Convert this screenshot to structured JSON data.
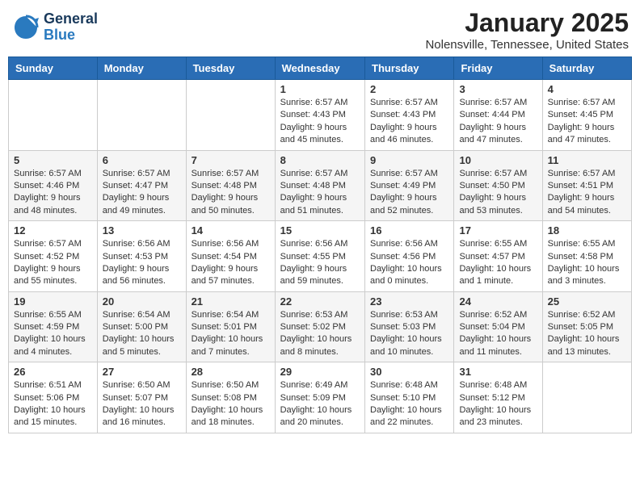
{
  "logo": {
    "line1": "General",
    "line2": "Blue"
  },
  "title": "January 2025",
  "location": "Nolensville, Tennessee, United States",
  "weekdays": [
    "Sunday",
    "Monday",
    "Tuesday",
    "Wednesday",
    "Thursday",
    "Friday",
    "Saturday"
  ],
  "weeks": [
    [
      {
        "day": "",
        "info": ""
      },
      {
        "day": "",
        "info": ""
      },
      {
        "day": "",
        "info": ""
      },
      {
        "day": "1",
        "info": "Sunrise: 6:57 AM\nSunset: 4:43 PM\nDaylight: 9 hours and 45 minutes."
      },
      {
        "day": "2",
        "info": "Sunrise: 6:57 AM\nSunset: 4:43 PM\nDaylight: 9 hours and 46 minutes."
      },
      {
        "day": "3",
        "info": "Sunrise: 6:57 AM\nSunset: 4:44 PM\nDaylight: 9 hours and 47 minutes."
      },
      {
        "day": "4",
        "info": "Sunrise: 6:57 AM\nSunset: 4:45 PM\nDaylight: 9 hours and 47 minutes."
      }
    ],
    [
      {
        "day": "5",
        "info": "Sunrise: 6:57 AM\nSunset: 4:46 PM\nDaylight: 9 hours and 48 minutes."
      },
      {
        "day": "6",
        "info": "Sunrise: 6:57 AM\nSunset: 4:47 PM\nDaylight: 9 hours and 49 minutes."
      },
      {
        "day": "7",
        "info": "Sunrise: 6:57 AM\nSunset: 4:48 PM\nDaylight: 9 hours and 50 minutes."
      },
      {
        "day": "8",
        "info": "Sunrise: 6:57 AM\nSunset: 4:48 PM\nDaylight: 9 hours and 51 minutes."
      },
      {
        "day": "9",
        "info": "Sunrise: 6:57 AM\nSunset: 4:49 PM\nDaylight: 9 hours and 52 minutes."
      },
      {
        "day": "10",
        "info": "Sunrise: 6:57 AM\nSunset: 4:50 PM\nDaylight: 9 hours and 53 minutes."
      },
      {
        "day": "11",
        "info": "Sunrise: 6:57 AM\nSunset: 4:51 PM\nDaylight: 9 hours and 54 minutes."
      }
    ],
    [
      {
        "day": "12",
        "info": "Sunrise: 6:57 AM\nSunset: 4:52 PM\nDaylight: 9 hours and 55 minutes."
      },
      {
        "day": "13",
        "info": "Sunrise: 6:56 AM\nSunset: 4:53 PM\nDaylight: 9 hours and 56 minutes."
      },
      {
        "day": "14",
        "info": "Sunrise: 6:56 AM\nSunset: 4:54 PM\nDaylight: 9 hours and 57 minutes."
      },
      {
        "day": "15",
        "info": "Sunrise: 6:56 AM\nSunset: 4:55 PM\nDaylight: 9 hours and 59 minutes."
      },
      {
        "day": "16",
        "info": "Sunrise: 6:56 AM\nSunset: 4:56 PM\nDaylight: 10 hours and 0 minutes."
      },
      {
        "day": "17",
        "info": "Sunrise: 6:55 AM\nSunset: 4:57 PM\nDaylight: 10 hours and 1 minute."
      },
      {
        "day": "18",
        "info": "Sunrise: 6:55 AM\nSunset: 4:58 PM\nDaylight: 10 hours and 3 minutes."
      }
    ],
    [
      {
        "day": "19",
        "info": "Sunrise: 6:55 AM\nSunset: 4:59 PM\nDaylight: 10 hours and 4 minutes."
      },
      {
        "day": "20",
        "info": "Sunrise: 6:54 AM\nSunset: 5:00 PM\nDaylight: 10 hours and 5 minutes."
      },
      {
        "day": "21",
        "info": "Sunrise: 6:54 AM\nSunset: 5:01 PM\nDaylight: 10 hours and 7 minutes."
      },
      {
        "day": "22",
        "info": "Sunrise: 6:53 AM\nSunset: 5:02 PM\nDaylight: 10 hours and 8 minutes."
      },
      {
        "day": "23",
        "info": "Sunrise: 6:53 AM\nSunset: 5:03 PM\nDaylight: 10 hours and 10 minutes."
      },
      {
        "day": "24",
        "info": "Sunrise: 6:52 AM\nSunset: 5:04 PM\nDaylight: 10 hours and 11 minutes."
      },
      {
        "day": "25",
        "info": "Sunrise: 6:52 AM\nSunset: 5:05 PM\nDaylight: 10 hours and 13 minutes."
      }
    ],
    [
      {
        "day": "26",
        "info": "Sunrise: 6:51 AM\nSunset: 5:06 PM\nDaylight: 10 hours and 15 minutes."
      },
      {
        "day": "27",
        "info": "Sunrise: 6:50 AM\nSunset: 5:07 PM\nDaylight: 10 hours and 16 minutes."
      },
      {
        "day": "28",
        "info": "Sunrise: 6:50 AM\nSunset: 5:08 PM\nDaylight: 10 hours and 18 minutes."
      },
      {
        "day": "29",
        "info": "Sunrise: 6:49 AM\nSunset: 5:09 PM\nDaylight: 10 hours and 20 minutes."
      },
      {
        "day": "30",
        "info": "Sunrise: 6:48 AM\nSunset: 5:10 PM\nDaylight: 10 hours and 22 minutes."
      },
      {
        "day": "31",
        "info": "Sunrise: 6:48 AM\nSunset: 5:12 PM\nDaylight: 10 hours and 23 minutes."
      },
      {
        "day": "",
        "info": ""
      }
    ]
  ]
}
